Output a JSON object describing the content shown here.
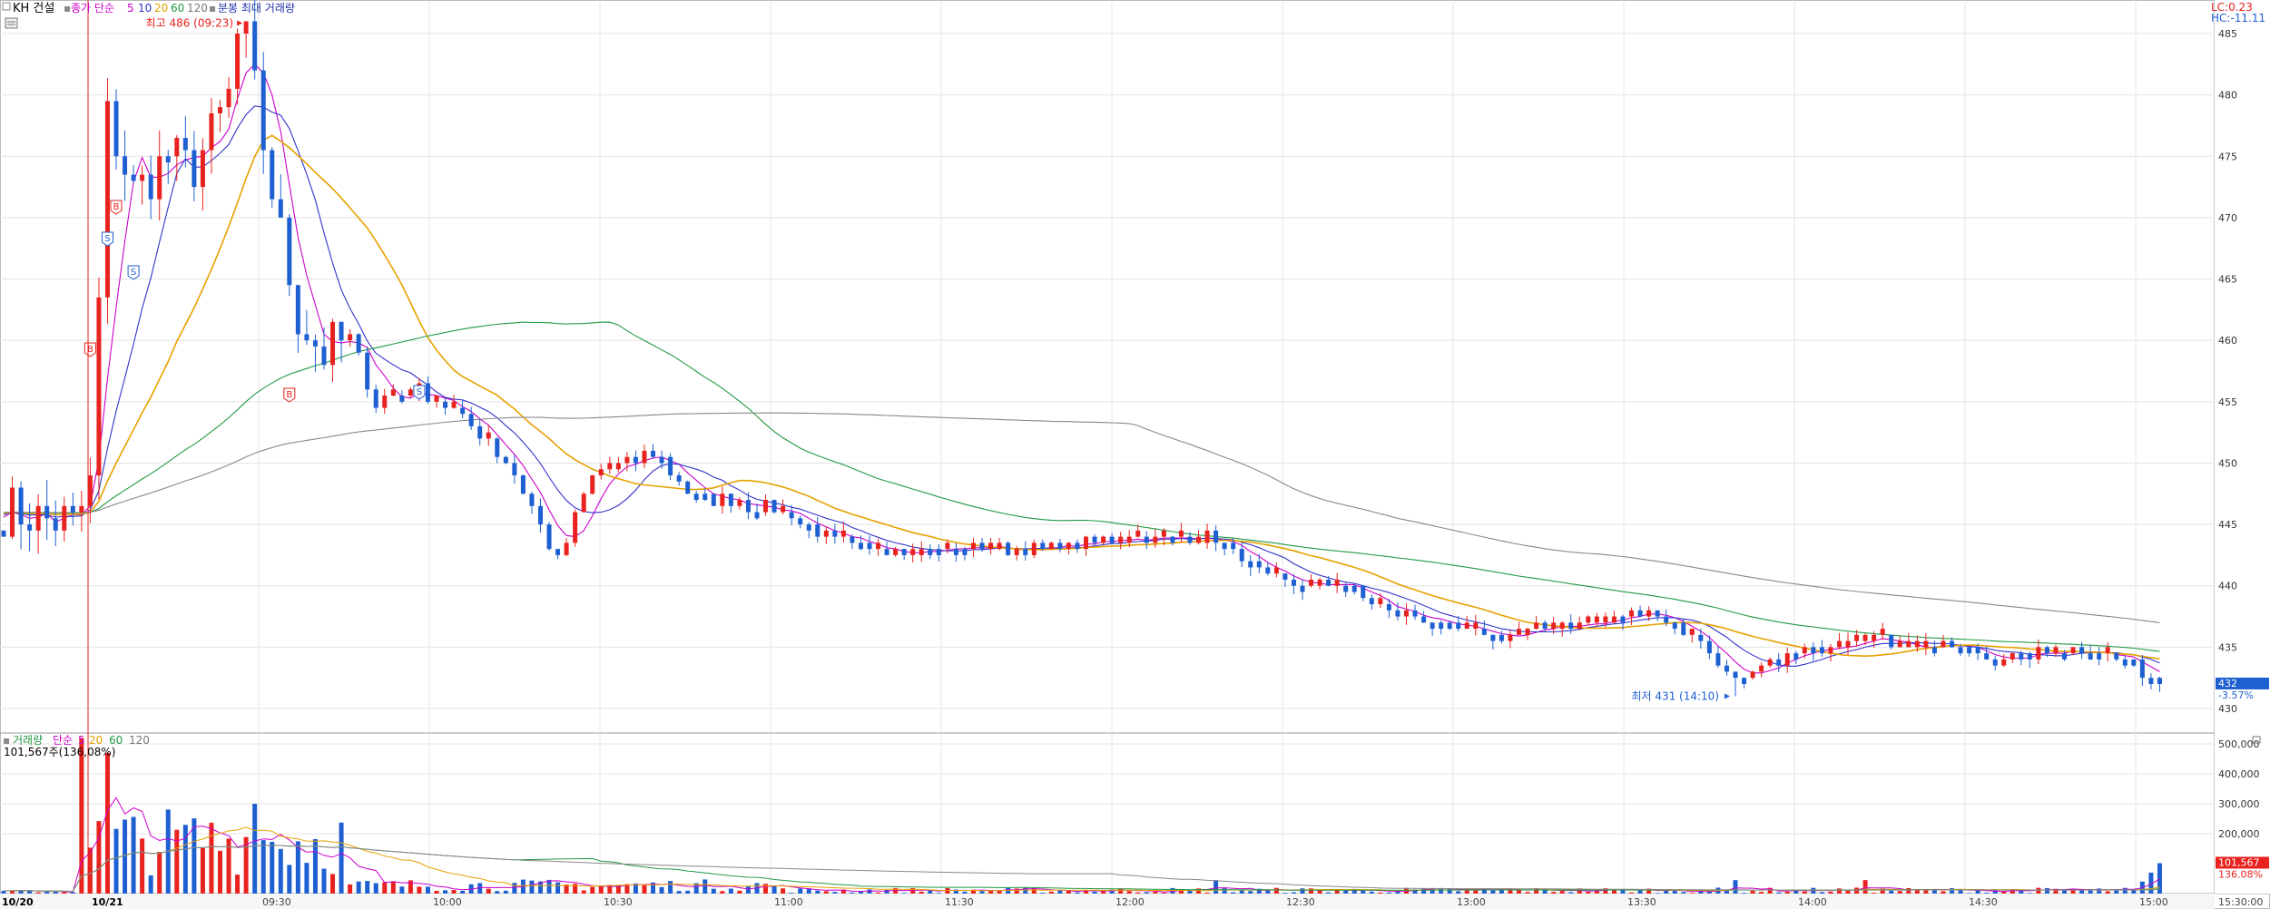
{
  "header": {
    "stock_name": "KH 건설",
    "price_legend": [
      {
        "label": "종가 단순",
        "color": "#cc00cc"
      },
      {
        "label": "5",
        "color": "#cc00cc"
      },
      {
        "label": "10",
        "color": "#3333cc"
      },
      {
        "label": "20",
        "color": "#e6a100"
      },
      {
        "label": "60",
        "color": "#229944"
      },
      {
        "label": "120",
        "color": "#777777"
      }
    ],
    "chart_kind": "분봉 최대 거래량",
    "lc_text": "LC:0.23",
    "hc_text": "HC:-11.11"
  },
  "volume_header": {
    "legend": [
      {
        "label": "거래량",
        "color": "#229944"
      },
      {
        "label": "단순",
        "color": "#cc00cc"
      },
      {
        "label": "5",
        "color": "#cc00cc"
      },
      {
        "label": "20",
        "color": "#e6a100"
      },
      {
        "label": "60",
        "color": "#229944"
      },
      {
        "label": "120",
        "color": "#777777"
      }
    ],
    "current": "101,567주(136,08%)"
  },
  "markers": {
    "high_label": "최고 486 (09:23)",
    "low_label": "최저 431 (14:10)",
    "current_price": "432",
    "current_change": "-3.57%",
    "current_volume": "101,567",
    "current_volume_pct": "136.08%"
  },
  "signals": [
    {
      "letter": "S",
      "type": "sell"
    },
    {
      "letter": "B",
      "type": "buy"
    },
    {
      "letter": "S",
      "type": "sell"
    },
    {
      "letter": "B",
      "type": "buy"
    },
    {
      "letter": "S",
      "type": "sell"
    },
    {
      "letter": "B",
      "type": "buy"
    }
  ],
  "colors": {
    "up": "#e8221e",
    "down": "#1e5fd2",
    "grid": "#e4e4e4",
    "ma5": "#cc00cc",
    "ma10": "#3333cc",
    "ma20": "#e6a100",
    "ma60": "#229944",
    "ma120": "#888888"
  },
  "chart_data": [
    {
      "type": "candlestick",
      "y_ticks": [
        485,
        480,
        475,
        470,
        465,
        460,
        455,
        450,
        445,
        440,
        435,
        430
      ],
      "ylim": [
        428.5,
        487.5
      ],
      "x_ticks": [
        "10/20",
        "10/21",
        "09:30",
        "10:00",
        "10:30",
        "11:00",
        "11:30",
        "12:00",
        "12:30",
        "13:00",
        "13:30",
        "14:00",
        "14:30",
        "15:00",
        "15:30:00"
      ],
      "close_anchors": [
        [
          0,
          446
        ],
        [
          8,
          445
        ],
        [
          10,
          448
        ],
        [
          12,
          478
        ],
        [
          15,
          472
        ],
        [
          19,
          475
        ],
        [
          22,
          474
        ],
        [
          25,
          478
        ],
        [
          28,
          484
        ],
        [
          31,
          472
        ],
        [
          34,
          462
        ],
        [
          37,
          459
        ],
        [
          40,
          460
        ],
        [
          43,
          455
        ],
        [
          48,
          456
        ],
        [
          52,
          454
        ],
        [
          56,
          452
        ],
        [
          60,
          448
        ],
        [
          64,
          442
        ],
        [
          68,
          449
        ],
        [
          72,
          450
        ],
        [
          75,
          451
        ],
        [
          80,
          447
        ],
        [
          85,
          447
        ],
        [
          90,
          446
        ],
        [
          95,
          444
        ],
        [
          100,
          443
        ],
        [
          110,
          443
        ],
        [
          120,
          443
        ],
        [
          130,
          444
        ],
        [
          140,
          444
        ],
        [
          145,
          441
        ],
        [
          150,
          440
        ],
        [
          155,
          440
        ],
        [
          160,
          438
        ],
        [
          165,
          437
        ],
        [
          170,
          436
        ],
        [
          175,
          436
        ],
        [
          180,
          437
        ],
        [
          185,
          437
        ],
        [
          190,
          438
        ],
        [
          195,
          436
        ],
        [
          200,
          432
        ],
        [
          205,
          434
        ],
        [
          210,
          435
        ],
        [
          215,
          436
        ],
        [
          220,
          435
        ],
        [
          225,
          435
        ],
        [
          230,
          434
        ],
        [
          240,
          435
        ],
        [
          245,
          434
        ],
        [
          249,
          432
        ]
      ],
      "high": 486,
      "low": 431
    },
    {
      "type": "bar",
      "series": [
        {
          "name": "거래량"
        }
      ],
      "y_ticks": [
        "500,000",
        "400,000",
        "300,000",
        "200,000"
      ],
      "ylim": [
        0,
        520000
      ],
      "bar_count": 250,
      "last_value": 101567
    }
  ]
}
